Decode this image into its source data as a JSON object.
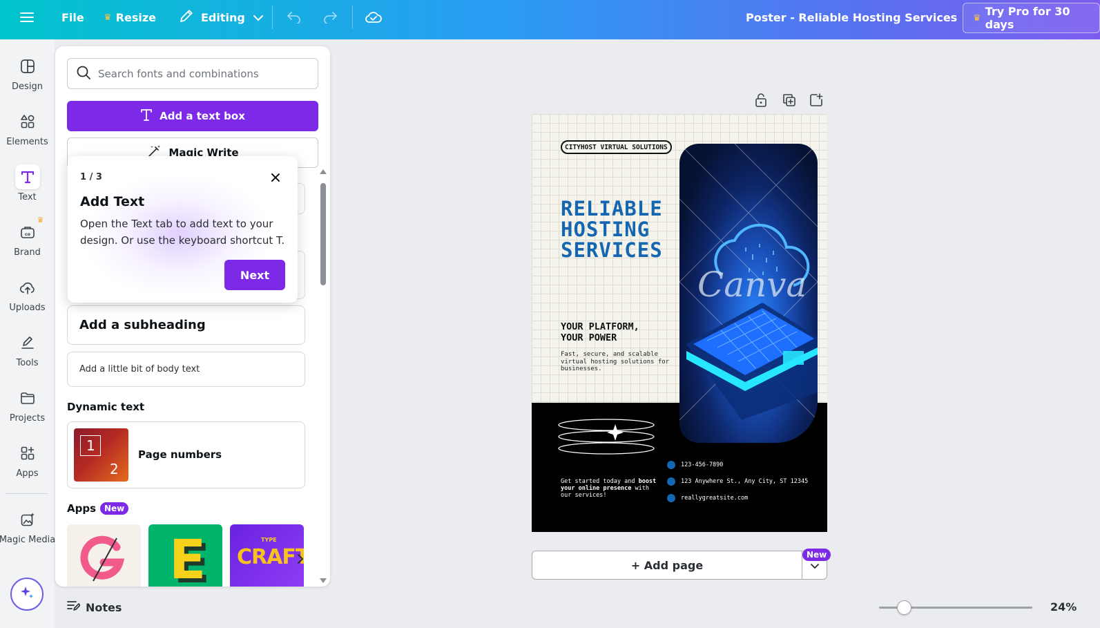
{
  "topbar": {
    "file_label": "File",
    "resize_label": "Resize",
    "editing_label": "Editing",
    "doc_title": "Poster - Reliable Hosting Services",
    "pro_label": "Try Pro for 30 days"
  },
  "rail": {
    "items": [
      {
        "label": "Design",
        "icon": "layout-icon"
      },
      {
        "label": "Elements",
        "icon": "shapes-icon"
      },
      {
        "label": "Text",
        "icon": "text-icon"
      },
      {
        "label": "Brand",
        "icon": "brand-icon"
      },
      {
        "label": "Uploads",
        "icon": "cloud-upload-icon"
      },
      {
        "label": "Tools",
        "icon": "pen-icon"
      },
      {
        "label": "Projects",
        "icon": "folder-icon"
      },
      {
        "label": "Apps",
        "icon": "apps-grid-icon"
      },
      {
        "label": "Magic Media",
        "icon": "magic-media-icon"
      }
    ]
  },
  "panel": {
    "search_placeholder": "Search fonts and combinations",
    "add_textbox_label": "Add a text box",
    "magic_write_label": "Magic Write",
    "subheading_label": "Add a subheading",
    "bodytext_label": "Add a little bit of body text",
    "dynamic_text_title": "Dynamic text",
    "page_numbers_label": "Page numbers",
    "page_numbers_thumb": {
      "a": "1",
      "b": "2"
    },
    "apps_title": "Apps",
    "apps_badge": "New",
    "app_tile_e": "E",
    "app_tile_craft_small": "TYPE",
    "app_tile_craft": "CRAFT"
  },
  "tooltip": {
    "step": "1 / 3",
    "title": "Add Text",
    "body": "Open the Text tab to add text to your design. Or use the keyboard shortcut T.",
    "next_label": "Next"
  },
  "poster": {
    "brand": "CITYHOST VIRTUAL SOLUTIONS",
    "headline": [
      "RELIABLE",
      "HOSTING",
      "SERVICES"
    ],
    "tagline": [
      "YOUR PLATFORM,",
      "YOUR POWER"
    ],
    "description": "Fast, secure, and scalable virtual hosting solutions for businesses.",
    "watermark": "Canva",
    "cta_parts": [
      "Get started today and ",
      "boost your online presence",
      " with our services!"
    ],
    "contacts": [
      "123-456-7890",
      "123 Anywhere St., Any City, ST 12345",
      "reallygreatsite.com"
    ]
  },
  "canvas": {
    "add_page_label": "+ Add page",
    "add_page_badge": "New"
  },
  "bottombar": {
    "notes_label": "Notes",
    "zoom_label": "24%",
    "zoom_level": 0.24
  },
  "colors": {
    "accent_purple": "#7d2ae8",
    "poster_blue": "#1566b0"
  }
}
